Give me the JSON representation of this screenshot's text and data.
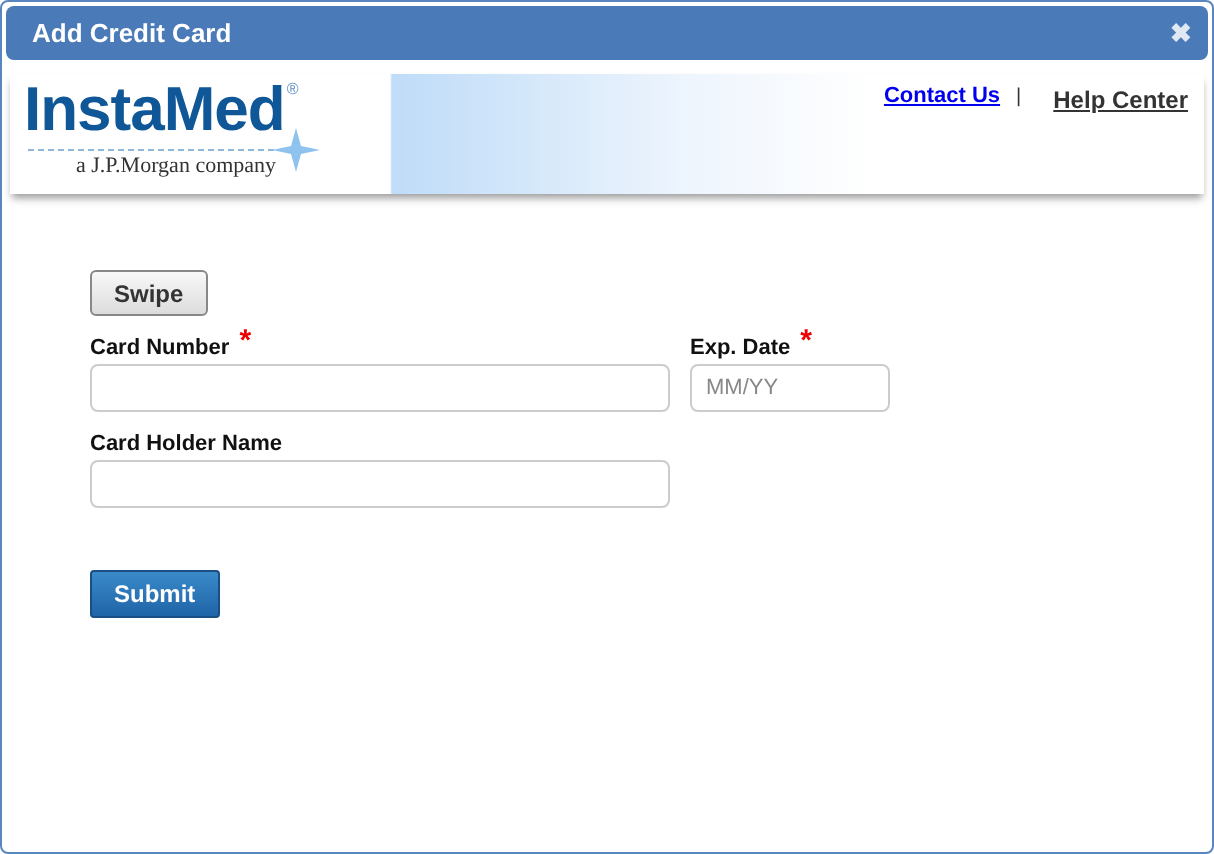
{
  "window": {
    "title": "Add Credit Card",
    "close": "✖"
  },
  "header": {
    "logo": {
      "name": "InstaMed",
      "mark": "®",
      "tagline": "a J.P.Morgan company"
    },
    "links": [
      {
        "label": "Contact Us",
        "kind": "link"
      },
      {
        "label": "|",
        "kind": "separator"
      },
      {
        "label": "Help Center",
        "kind": "link"
      }
    ]
  },
  "swipe_button": "Swipe",
  "fields": [
    {
      "label": "Card Number",
      "required_mark": "*",
      "kind": "wide"
    },
    {
      "label": "Exp. Date",
      "required_mark": "*",
      "placeholder": "MM/YY",
      "kind": "narrow"
    },
    {
      "label": "Card Holder Name",
      "kind": "wide"
    }
  ],
  "submit_button": "Submit"
}
